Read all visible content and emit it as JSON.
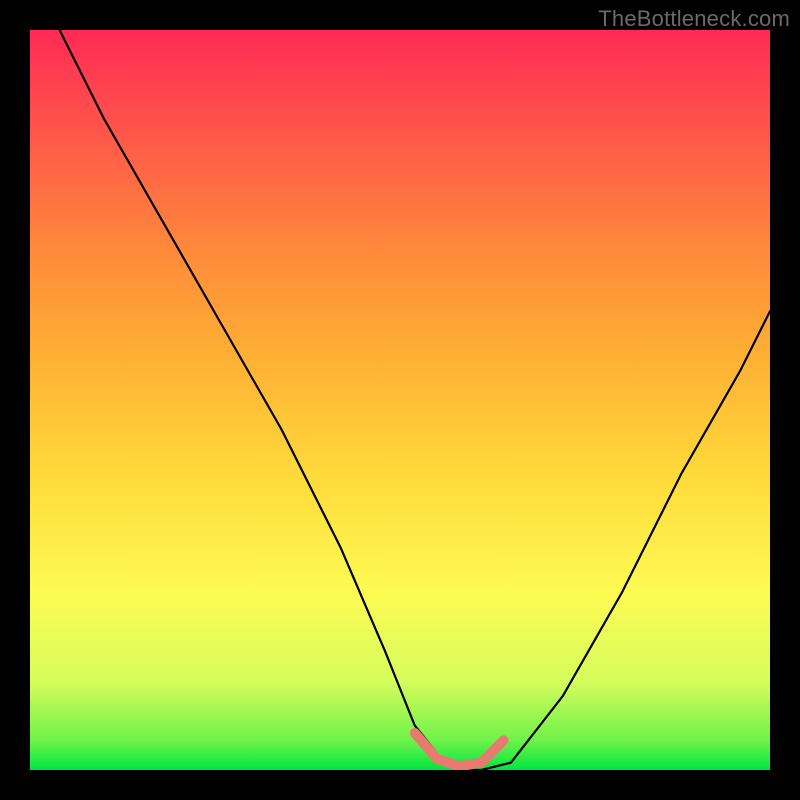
{
  "watermark": "TheBottleneck.com",
  "colors": {
    "background": "#000000",
    "curve": "#000000",
    "highlight": "#e97a6f",
    "gradient_stops": [
      "#00e640",
      "#6ff24a",
      "#d6fd5c",
      "#fdfb52",
      "#ffd93a",
      "#ffb234",
      "#ff8a3a",
      "#ff5a49",
      "#ff2a55"
    ]
  },
  "chart_data": {
    "type": "line",
    "title": "",
    "xlabel": "",
    "ylabel": "",
    "xlim": [
      0,
      100
    ],
    "ylim": [
      0,
      100
    ],
    "note": "V-shaped bottleneck curve with flat trough; small highlighted segment at the trough. Values estimated from pixel positions.",
    "series": [
      {
        "name": "bottleneck-curve",
        "x": [
          4,
          10,
          18,
          26,
          34,
          42,
          48,
          52,
          56,
          59,
          61,
          65,
          72,
          80,
          88,
          96,
          100
        ],
        "y": [
          100,
          88,
          74,
          60,
          46,
          30,
          16,
          6,
          1,
          0,
          0,
          1,
          10,
          24,
          40,
          54,
          62
        ]
      }
    ],
    "highlight_segment": {
      "x": [
        52,
        55,
        58,
        61,
        64
      ],
      "y": [
        5,
        1.5,
        0.5,
        1,
        4
      ]
    }
  }
}
